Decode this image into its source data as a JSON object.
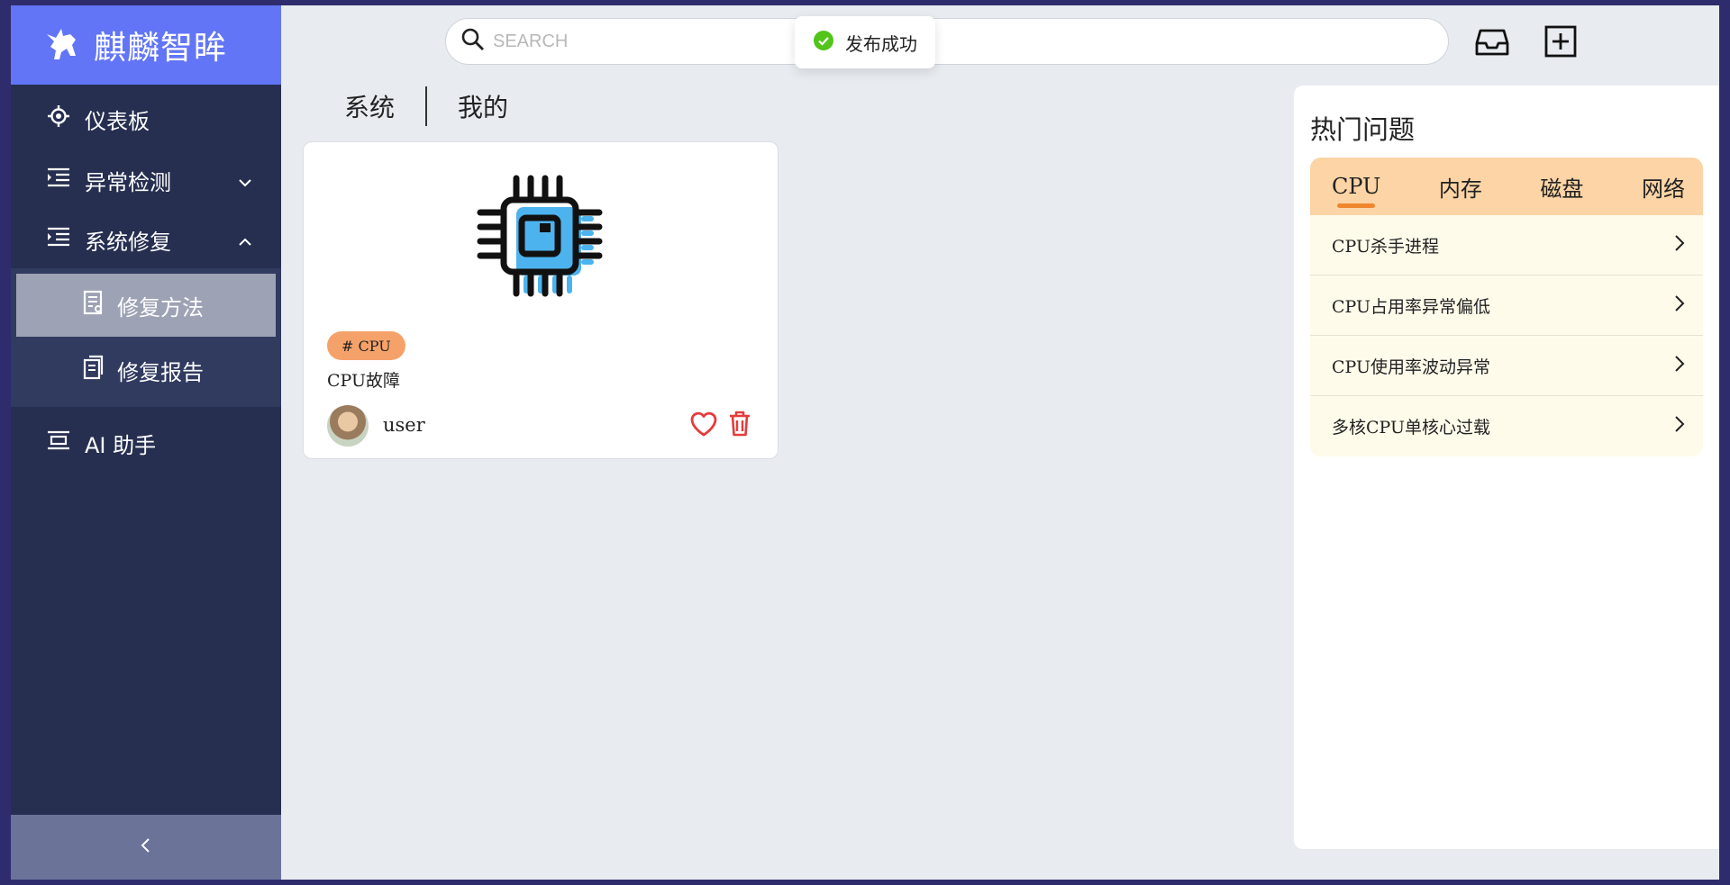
{
  "brand": {
    "title": "麒麟智眸",
    "logo_icon": "unicorn-logo-icon"
  },
  "sidebar": {
    "items": [
      {
        "label": "仪表板",
        "icon": "crosshair-icon"
      },
      {
        "label": "异常检测",
        "icon": "indent-list-icon",
        "expanded": false
      },
      {
        "label": "系统修复",
        "icon": "indent-list-icon",
        "expanded": true
      },
      {
        "label": "AI 助手",
        "icon": "assistant-icon"
      }
    ],
    "subitems": [
      {
        "label": "修复方法",
        "icon": "document-icon",
        "active": true
      },
      {
        "label": "修复报告",
        "icon": "clipboard-icon",
        "active": false
      }
    ],
    "collapse_glyph": "<"
  },
  "header": {
    "search_placeholder": "SEARCH"
  },
  "toast": {
    "message": "发布成功",
    "color": "#52c41a"
  },
  "tabs": [
    {
      "label": "系统"
    },
    {
      "label": "我的"
    }
  ],
  "card": {
    "tag": "# CPU",
    "title": "CPU故障",
    "user": "user",
    "accent": "#e63b3b"
  },
  "hot": {
    "title": "热门问题",
    "tabs": [
      "CPU",
      "内存",
      "磁盘",
      "网络"
    ],
    "active_tab": "CPU",
    "items": [
      "CPU杀手进程",
      "CPU占用率异常偏低",
      "CPU使用率波动异常",
      "多核CPU单核心过载"
    ]
  }
}
